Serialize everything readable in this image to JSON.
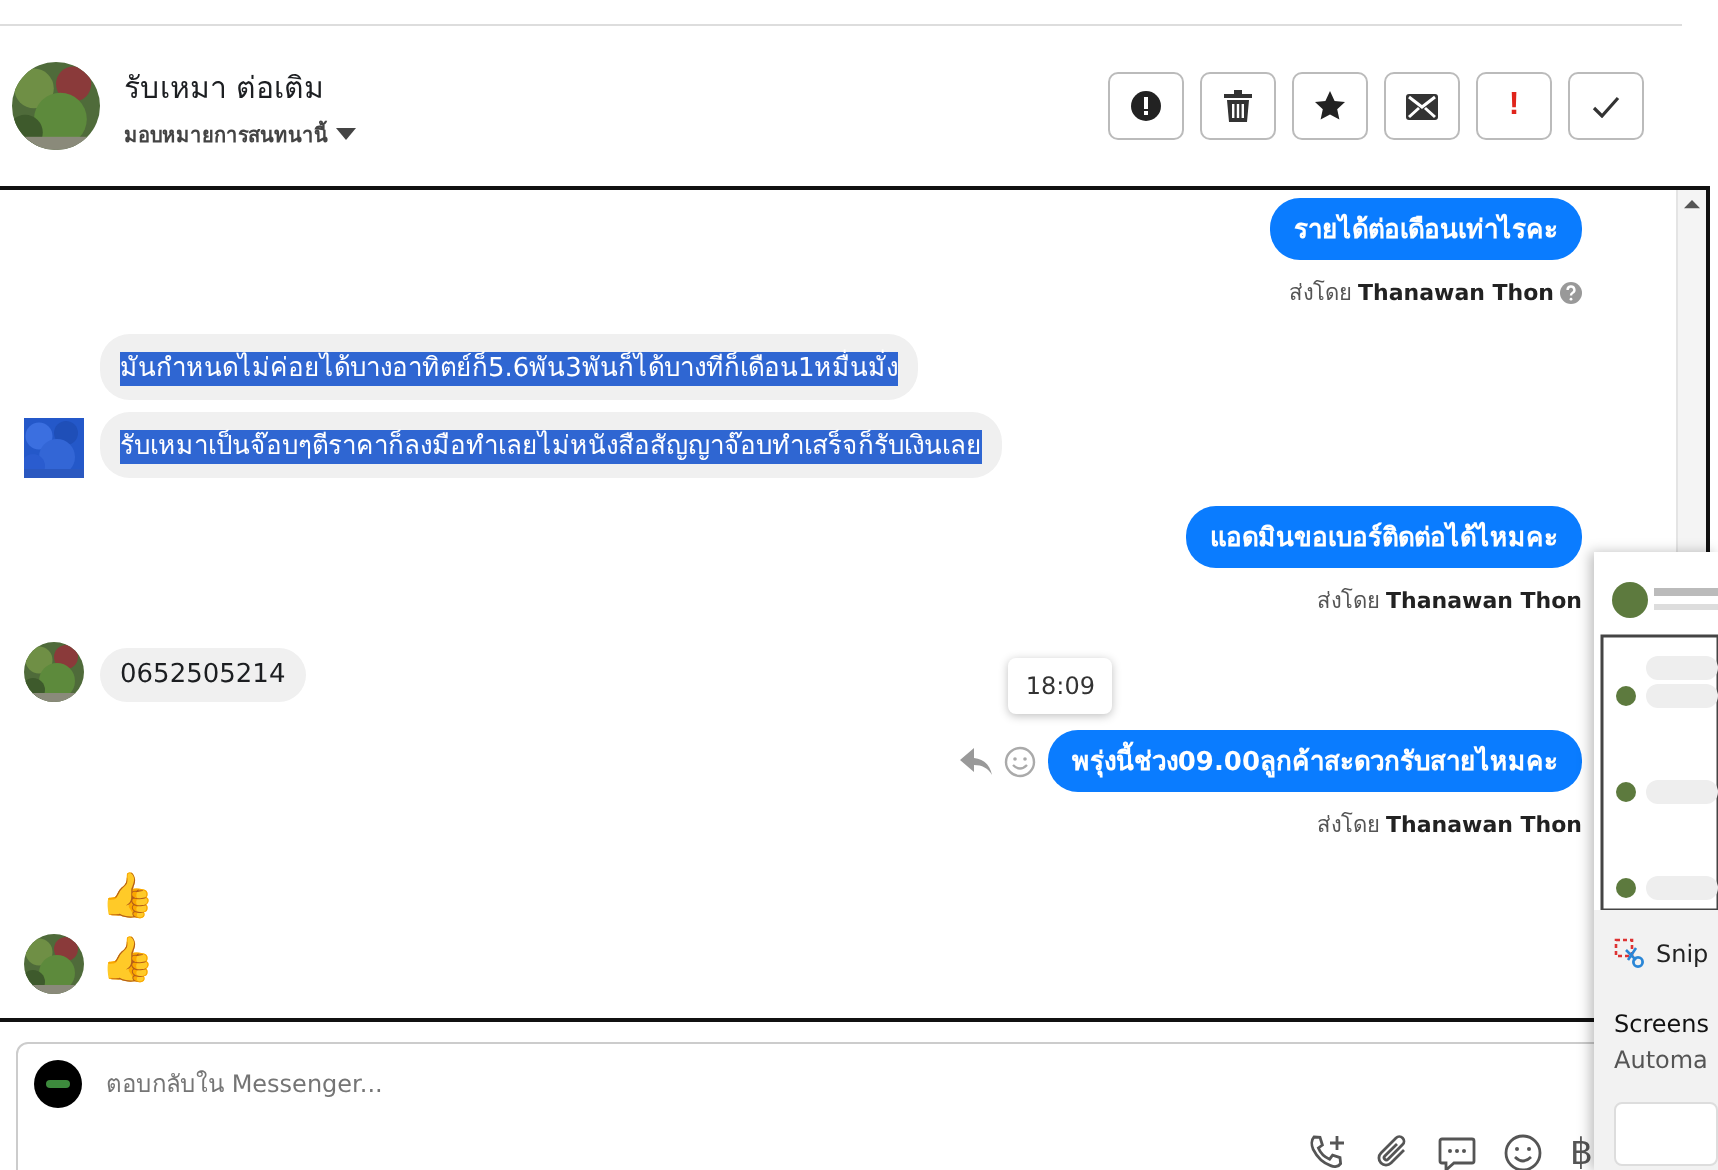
{
  "header": {
    "name": "รับเหมา ต่อเติม",
    "assign_label": "มอบหมายการสนทนานี้"
  },
  "actions": [
    {
      "kind": "info"
    },
    {
      "kind": "delete"
    },
    {
      "kind": "star"
    },
    {
      "kind": "mail"
    },
    {
      "kind": "flag",
      "label": "!"
    },
    {
      "kind": "done"
    }
  ],
  "messages": [
    {
      "kind": "outgoing",
      "text": "รายได้ต่อเดือนเท่าไรคะ",
      "sent_by_label": "ส่งโดย",
      "sender": "Thanawan Thon",
      "help_icon": true
    },
    {
      "kind": "incoming",
      "avatar_selected": true,
      "bubbles": [
        {
          "text": "มันกำหนดไม่ค่อยได้บางอาทิตย์ก็5.6พัน3พันก็ได้บางทีก็เดือน1หมื่นมั่ง",
          "selected": true
        },
        {
          "text": "รับเหมาเป็นจ๊อบๆตีราคาก็ลงมือทำเลยไม่หนังสือสัญญาจ๊อบทำเสร็จก็รับเงินเลย",
          "selected": true
        }
      ]
    },
    {
      "kind": "outgoing",
      "text": "แอดมินขอเบอร์ติดต่อได้ไหมคะ",
      "sent_by_label": "ส่งโดย",
      "sender": "Thanawan Thon",
      "help_icon": false
    },
    {
      "kind": "incoming",
      "avatar_selected": false,
      "bubbles": [
        {
          "text": "0652505214",
          "selected": false
        }
      ]
    },
    {
      "kind": "outgoing",
      "text": "พรุ่งนี้ช่วง09.00ลูกค้าสะดวกรับสายไหมคะ",
      "sent_by_label": "ส่งโดย",
      "sender": "Thanawan Thon",
      "help_icon": false,
      "tooltip": "18:09",
      "hover_actions": true
    },
    {
      "kind": "emoji",
      "avatar_selected": false,
      "items": [
        "👍",
        "👍"
      ]
    }
  ],
  "composer": {
    "placeholder": "ตอบกลับใน Messenger...",
    "tools": [
      {
        "kind": "call"
      },
      {
        "kind": "attach"
      },
      {
        "kind": "chat"
      },
      {
        "kind": "emoji"
      },
      {
        "kind": "currency",
        "label": "฿"
      }
    ]
  },
  "notification": {
    "app": "Snip",
    "title": "Screens",
    "subtitle": "Automa"
  }
}
